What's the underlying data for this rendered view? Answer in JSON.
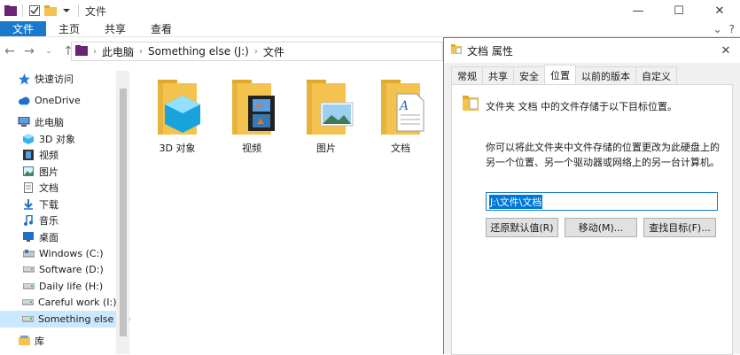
{
  "window": {
    "title": "文件",
    "caption_buttons": {
      "minimize": "—",
      "maximize": "☐",
      "close": "✕"
    }
  },
  "ribbon": {
    "tabs": [
      {
        "label": "文件",
        "active": true
      },
      {
        "label": "主页",
        "active": false
      },
      {
        "label": "共享",
        "active": false
      },
      {
        "label": "查看",
        "active": false
      }
    ],
    "expand_glyph": "⌄",
    "help_glyph": "?"
  },
  "address": {
    "crumbs": [
      "此电脑",
      "Something else (J:)",
      "文件"
    ]
  },
  "sidebar": {
    "items": [
      {
        "label": "快速访问",
        "icon": "star-icon",
        "level": 1
      },
      {
        "label": "OneDrive",
        "icon": "cloud-icon",
        "level": 1
      },
      {
        "label": "此电脑",
        "icon": "pc-icon",
        "level": 1
      },
      {
        "label": "3D 对象",
        "icon": "cube-icon",
        "level": 2
      },
      {
        "label": "视频",
        "icon": "video-icon",
        "level": 2
      },
      {
        "label": "图片",
        "icon": "picture-icon",
        "level": 2
      },
      {
        "label": "文档",
        "icon": "document-icon",
        "level": 2
      },
      {
        "label": "下载",
        "icon": "download-icon",
        "level": 2
      },
      {
        "label": "音乐",
        "icon": "music-icon",
        "level": 2
      },
      {
        "label": "桌面",
        "icon": "desktop-icon",
        "level": 2
      },
      {
        "label": "Windows (C:)",
        "icon": "drive-icon",
        "level": 2
      },
      {
        "label": "Software (D:)",
        "icon": "drive-icon",
        "level": 2
      },
      {
        "label": "Daily life (H:)",
        "icon": "drive-icon",
        "level": 2
      },
      {
        "label": "Careful work (I:)",
        "icon": "drive-icon",
        "level": 2
      },
      {
        "label": "Something else (J:)",
        "icon": "drive-icon",
        "level": 2,
        "selected": true
      },
      {
        "label": "库",
        "icon": "library-icon",
        "level": 1
      }
    ]
  },
  "content": {
    "folders": [
      {
        "label": "3D 对象",
        "icon": "folder-3d-icon"
      },
      {
        "label": "视频",
        "icon": "folder-video-icon"
      },
      {
        "label": "图片",
        "icon": "folder-pictures-icon"
      },
      {
        "label": "文档",
        "icon": "folder-documents-icon"
      }
    ]
  },
  "dialog": {
    "title": "文档 属性",
    "tabs": [
      {
        "label": "常规",
        "active": false
      },
      {
        "label": "共享",
        "active": false
      },
      {
        "label": "安全",
        "active": false
      },
      {
        "label": "位置",
        "active": true
      },
      {
        "label": "以前的版本",
        "active": false
      },
      {
        "label": "自定义",
        "active": false
      }
    ],
    "description": "文件夹 文档 中的文件存储于以下目标位置。",
    "info": "你可以将此文件夹中文件存储的位置更改为此硬盘上的另一个位置、另一个驱动器或网络上的另一台计算机。",
    "path_value": "J:\\文件\\文档",
    "buttons": {
      "restore": "还原默认值(R)",
      "move": "移动(M)...",
      "find_target": "查找目标(F)..."
    },
    "close_glyph": "✕"
  },
  "colors": {
    "accent": "#1979ca",
    "selection": "#cce8ff",
    "folder": "#f4c34f"
  }
}
